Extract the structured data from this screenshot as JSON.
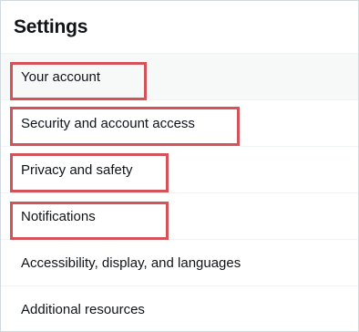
{
  "settings": {
    "title": "Settings",
    "items": [
      {
        "label": "Your account",
        "highlighted": true,
        "active": true
      },
      {
        "label": "Security and account access",
        "highlighted": true
      },
      {
        "label": "Privacy and safety",
        "highlighted": true
      },
      {
        "label": "Notifications",
        "highlighted": true
      },
      {
        "label": "Accessibility, display, and languages",
        "highlighted": false
      },
      {
        "label": "Additional resources",
        "highlighted": false
      }
    ]
  },
  "colors": {
    "highlight_border": "#d4525a",
    "active_row_background": "#f7f9f9",
    "divider": "#eff3f4"
  }
}
